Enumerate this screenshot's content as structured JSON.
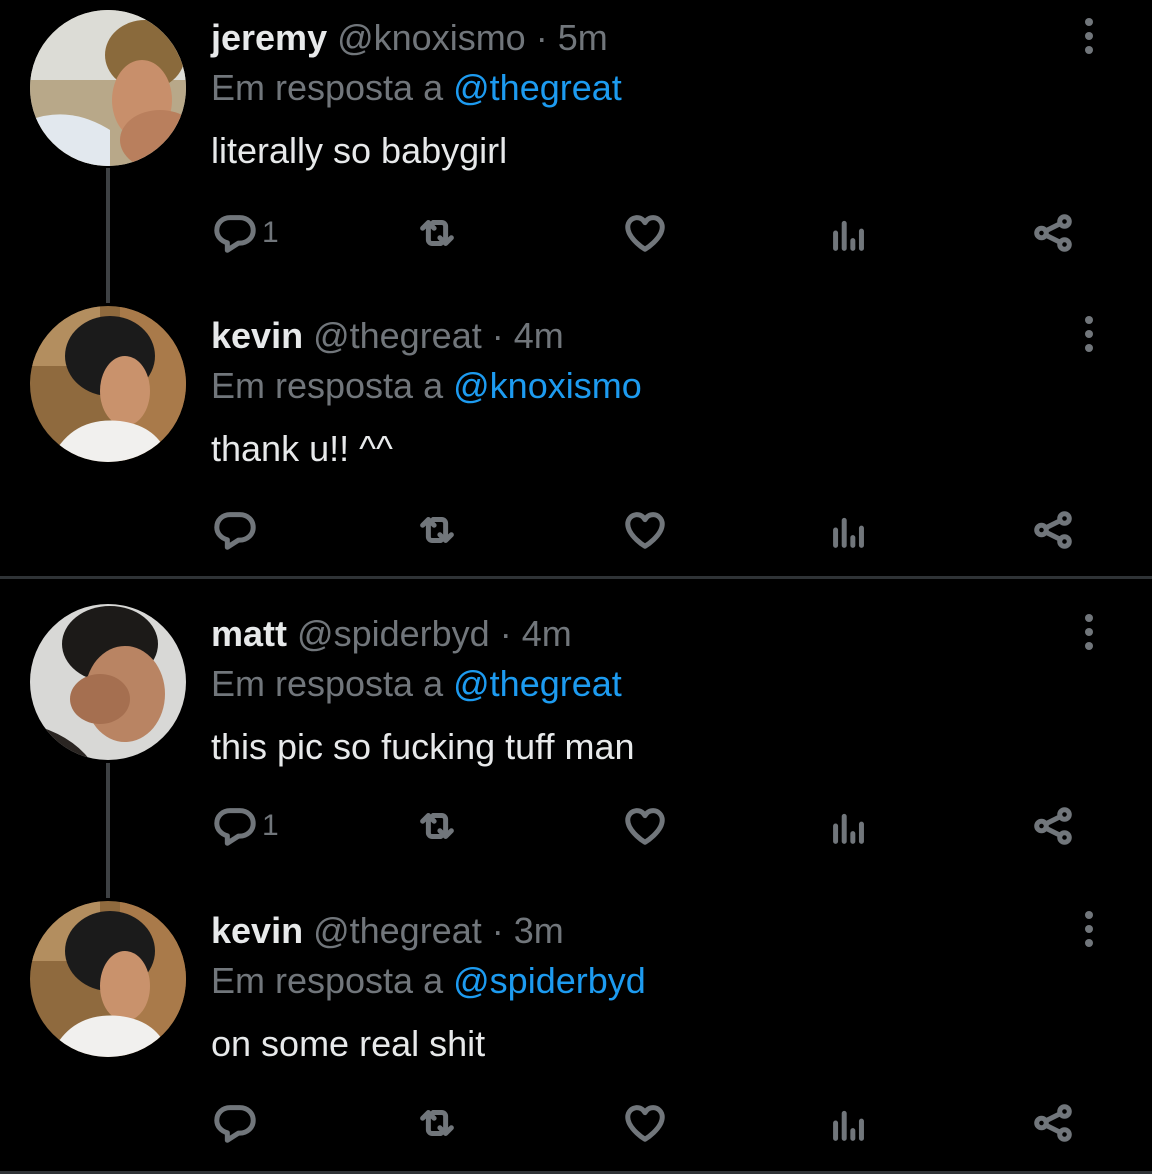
{
  "reply_prefix": "Em resposta a",
  "separator": "·",
  "colors": {
    "background": "#000000",
    "text": "#e7e9ea",
    "muted": "#71767b",
    "mention": "#1d9bf0",
    "thread_line": "#3e4144"
  },
  "icons": [
    "reply-icon",
    "retweet-icon",
    "like-icon",
    "views-icon",
    "share-icon",
    "more-icon"
  ],
  "tweets": [
    {
      "name": "jeremy",
      "handle": "@knoxismo",
      "time": "5m",
      "reply_to": "@thegreat",
      "text": "literally so babygirl",
      "reply_count": "1"
    },
    {
      "name": "kevin",
      "handle": "@thegreat",
      "time": "4m",
      "reply_to": "@knoxismo",
      "text": "thank u!! ^^",
      "reply_count": ""
    },
    {
      "name": "matt",
      "handle": "@spiderbyd",
      "time": "4m",
      "reply_to": "@thegreat",
      "text": "this pic so fucking tuff man",
      "reply_count": "1"
    },
    {
      "name": "kevin",
      "handle": "@thegreat",
      "time": "3m",
      "reply_to": "@spiderbyd",
      "text": "on some real shit",
      "reply_count": ""
    }
  ]
}
